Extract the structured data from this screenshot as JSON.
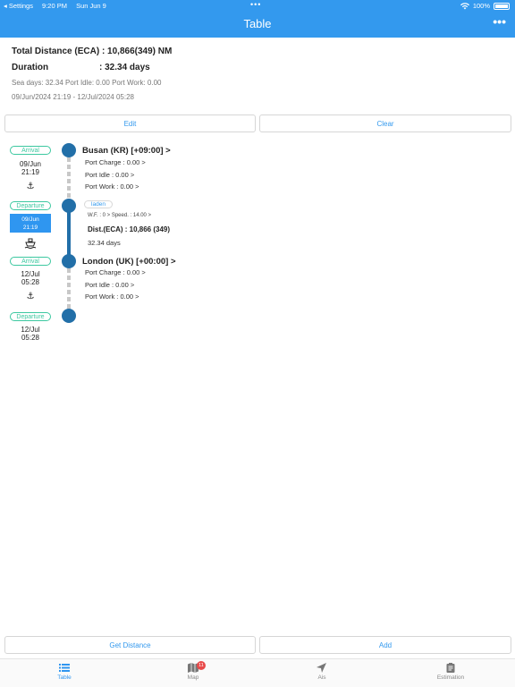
{
  "status": {
    "back": "◂ Settings",
    "time": "9:20 PM",
    "date": "Sun Jun 9",
    "dots": "•••",
    "battery": "100%"
  },
  "nav": {
    "title": "Table",
    "more": "•••"
  },
  "summary": {
    "total_distance": "Total Distance (ECA) : 10,866(349) NM",
    "duration_label": "Duration",
    "duration_value": ": 32.34 days",
    "days_line": "Sea days: 32.34  Port Idle: 0.00  Port Work: 0.00",
    "range_line": "09/Jun/2024 21:19   -   12/Jul/2024 05:28"
  },
  "actions": {
    "edit": "Edit",
    "clear": "Clear",
    "get_distance": "Get Distance",
    "add": "Add"
  },
  "timeline": {
    "busan": {
      "arrival_badge": "Arrival",
      "arrival_date": "09/Jun",
      "arrival_time": "21:19",
      "name": "Busan (KR) [+09:00] >",
      "port_charge": "Port Charge : 0.00 >",
      "port_idle": "Port Idle : 0.00 >",
      "port_work": "Port Work : 0.00 >",
      "departure_badge": "Departure",
      "departure_date": "09/Jun",
      "departure_time": "21:19"
    },
    "leg": {
      "status": "laden",
      "wf_speed": "W.F. : 0 >    Speed. : 14.00 >",
      "distance": "Dist.(ECA) : 10,866 (349)",
      "days": "32.34 days"
    },
    "london": {
      "arrival_badge": "Arrival",
      "arrival_date": "12/Jul",
      "arrival_time": "05:28",
      "name": "London (UK) [+00:00] >",
      "port_charge": "Port Charge : 0.00 >",
      "port_idle": "Port Idle : 0.00 >",
      "port_work": "Port Work : 0.00 >",
      "departure_badge": "Departure",
      "departure_date": "12/Jul",
      "departure_time": "05:28"
    }
  },
  "tabs": [
    {
      "label": "Table",
      "icon": "list-icon"
    },
    {
      "label": "Map",
      "icon": "map-icon",
      "badge": "11"
    },
    {
      "label": "Ais",
      "icon": "navigation-arrow-icon"
    },
    {
      "label": "Estimation",
      "icon": "clipboard-icon"
    }
  ],
  "colors": {
    "accent": "#3399ee",
    "timeline": "#226fa8",
    "badge": "#3cc8a0",
    "notification": "#e84a4a"
  }
}
